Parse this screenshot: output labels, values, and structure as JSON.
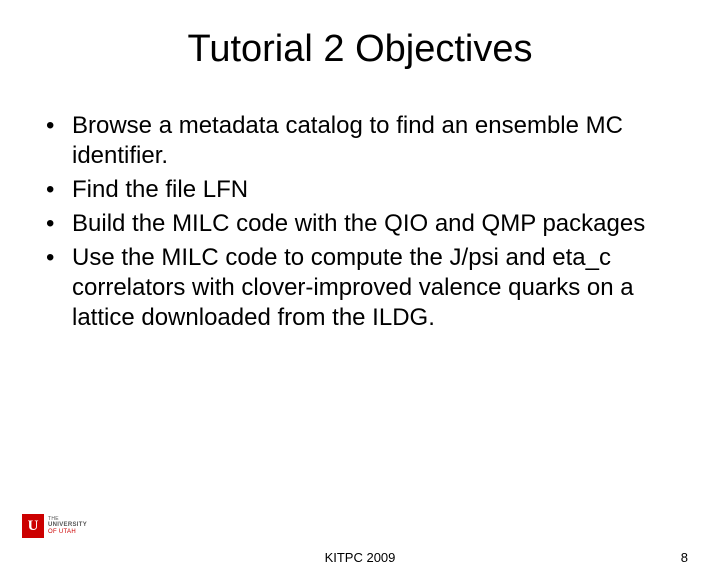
{
  "title": "Tutorial 2 Objectives",
  "bullets": [
    "Browse a metadata catalog to find an ensemble MC identifier.",
    "Find the file LFN",
    "Build the MILC code with the QIO and QMP packages",
    "Use the MILC code to compute the J/psi and eta_c correlators with clover-improved valence quarks on a lattice downloaded from the ILDG."
  ],
  "footer": {
    "center": "KITPC 2009",
    "page": "8"
  },
  "logo": {
    "letter": "U",
    "line1": "THE",
    "line2": "UNIVERSITY",
    "line3": "OF UTAH"
  }
}
